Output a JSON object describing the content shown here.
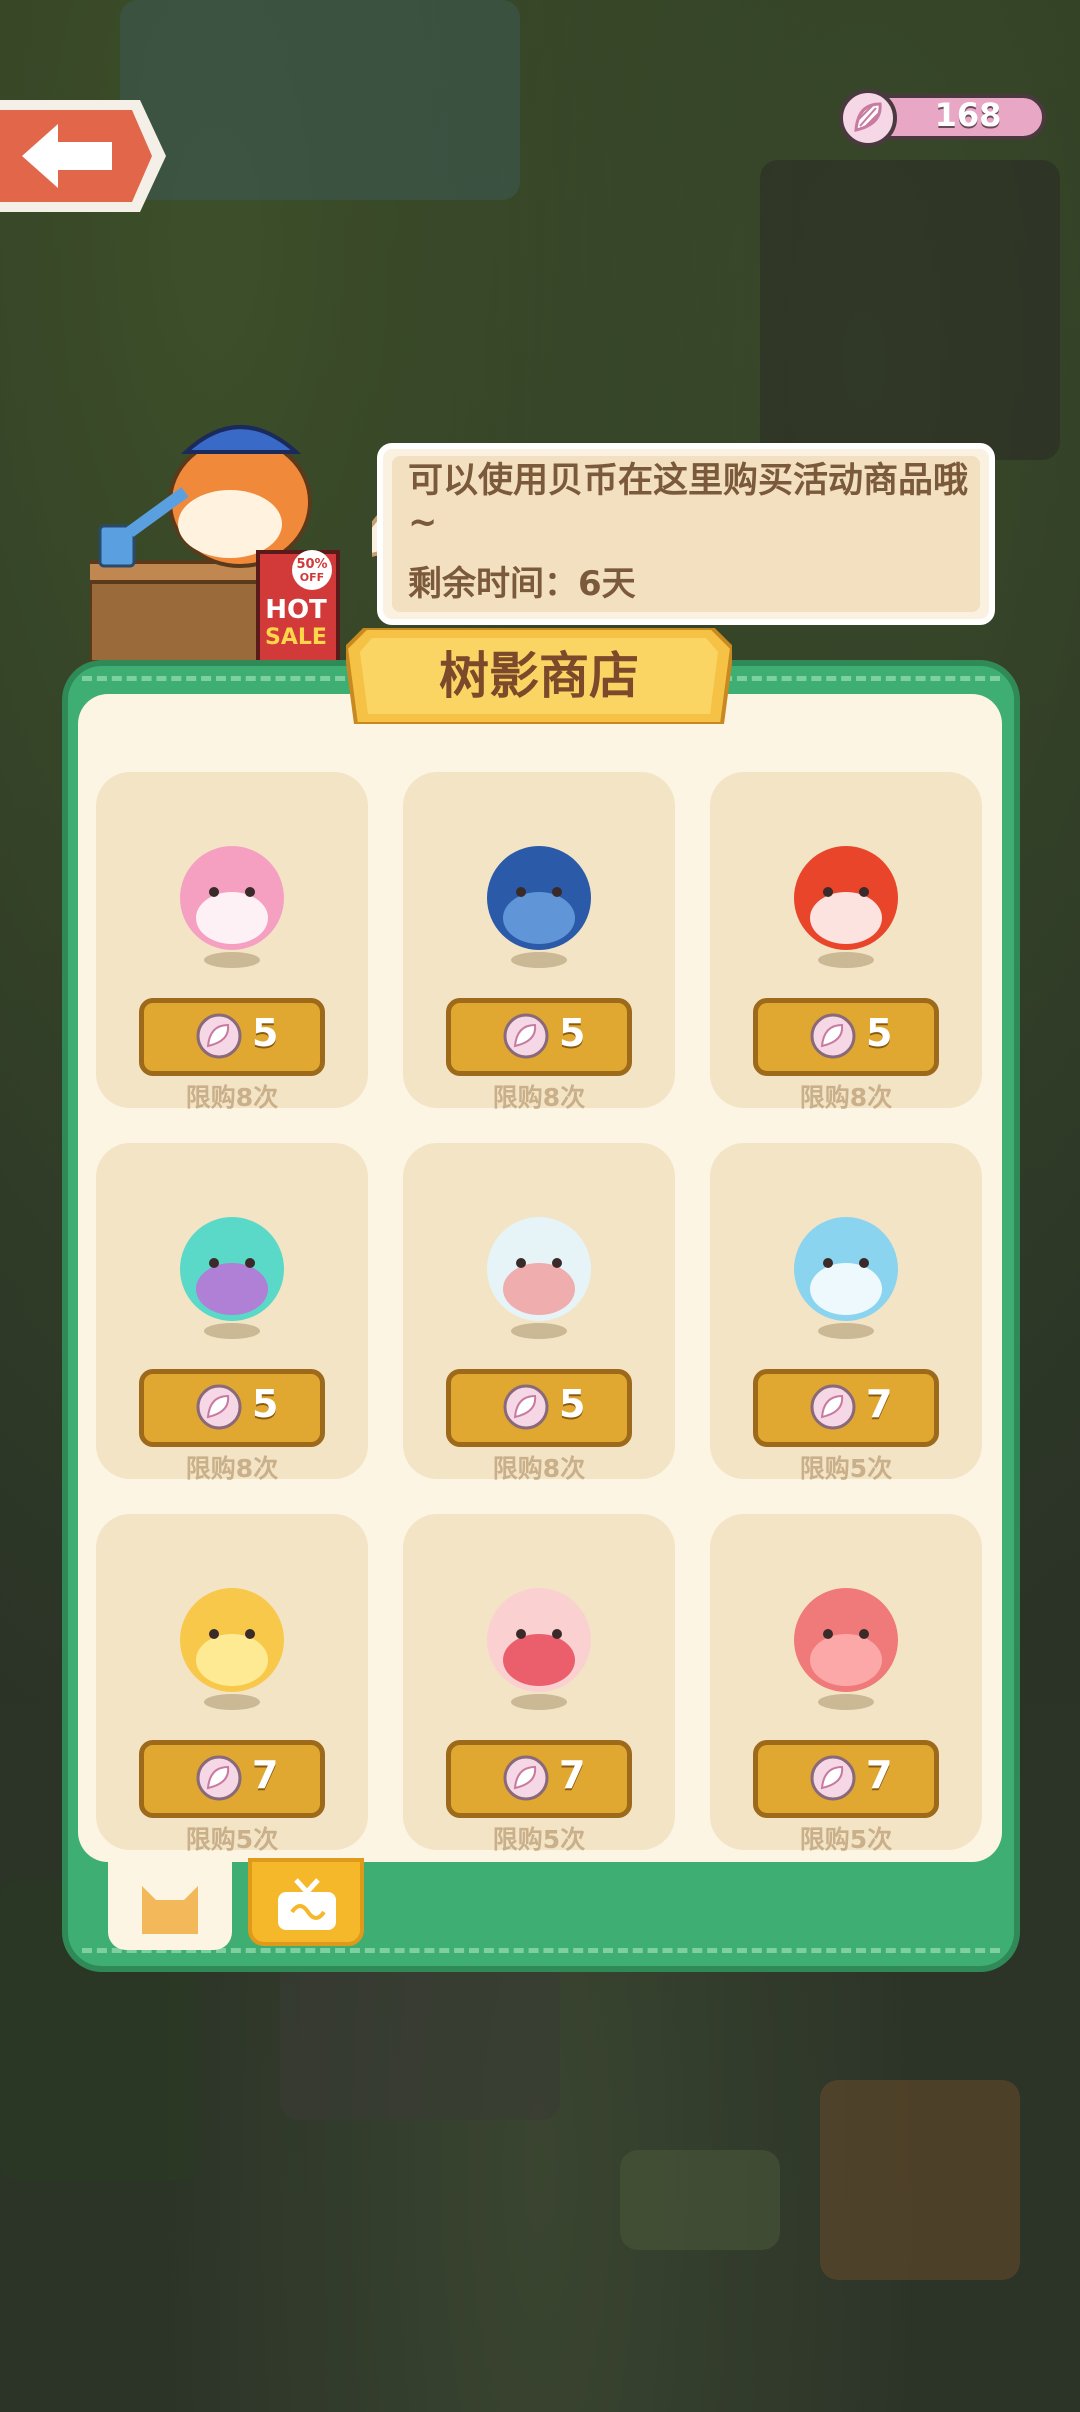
{
  "header": {
    "coin_count": "168"
  },
  "speech": {
    "line1": "可以使用贝币在这里购买活动商品哦~",
    "line2": "剩余时间：6天"
  },
  "shopkeeper": {
    "sign_line1": "50%",
    "sign_line2": "OFF",
    "sign_line3": "HOT",
    "sign_line4": "SALE"
  },
  "shop": {
    "title": "树影商店",
    "items": [
      {
        "pet": "pink-fox-pet",
        "price": "5",
        "limit": "限购8次"
      },
      {
        "pet": "blue-bird-pet",
        "price": "5",
        "limit": "限购8次"
      },
      {
        "pet": "red-bird-pet",
        "price": "5",
        "limit": "限购8次"
      },
      {
        "pet": "jellyfish-pet",
        "price": "5",
        "limit": "限购8次"
      },
      {
        "pet": "panda-pet",
        "price": "5",
        "limit": "限购8次"
      },
      {
        "pet": "bunny-pet",
        "price": "7",
        "limit": "限购5次"
      },
      {
        "pet": "lion-pet",
        "price": "7",
        "limit": "限购5次"
      },
      {
        "pet": "flamingo-pet",
        "price": "7",
        "limit": "限购5次"
      },
      {
        "pet": "rose-cat-pet",
        "price": "7",
        "limit": "限购5次"
      }
    ]
  },
  "tabs": [
    {
      "icon": "cat-icon",
      "active": true
    },
    {
      "icon": "tv-icon",
      "active": false
    }
  ]
}
